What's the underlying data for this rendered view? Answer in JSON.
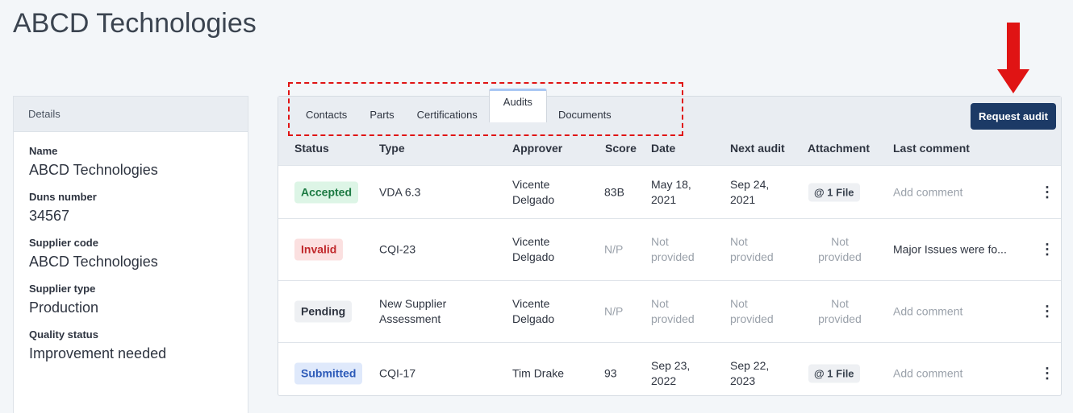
{
  "page_title": "ABCD Technologies",
  "details": {
    "header": "Details",
    "fields": [
      {
        "label": "Name",
        "value": "ABCD Technologies"
      },
      {
        "label": "Duns number",
        "value": "34567"
      },
      {
        "label": "Supplier code",
        "value": "ABCD Technologies"
      },
      {
        "label": "Supplier type",
        "value": "Production"
      },
      {
        "label": "Quality status",
        "value": "Improvement needed"
      }
    ]
  },
  "tabs": [
    "Contacts",
    "Parts",
    "Certifications",
    "Audits",
    "Documents"
  ],
  "active_tab": "Audits",
  "request_button": "Request audit",
  "columns": [
    "Status",
    "Type",
    "Approver",
    "Score",
    "Date",
    "Next audit",
    "Attachment",
    "Last comment"
  ],
  "rows": [
    {
      "status": "Accepted",
      "type": "VDA 6.3",
      "approver": "Vicente Delgado",
      "score": "83B",
      "date": "May 18, 2021",
      "next_audit": "Sep 24, 2021",
      "attachment": "1 File",
      "comment": "Add comment"
    },
    {
      "status": "Invalid",
      "type": "CQI-23",
      "approver": "Vicente Delgado",
      "score": "N/P",
      "date": "Not provided",
      "next_audit": "Not provided",
      "attachment": "Not provided",
      "comment": "Major Issues were fo..."
    },
    {
      "status": "Pending",
      "type": "New Supplier Assessment",
      "approver": "Vicente Delgado",
      "score": "N/P",
      "date": "Not provided",
      "next_audit": "Not provided",
      "attachment": "Not provided",
      "comment": "Add comment"
    },
    {
      "status": "Submitted",
      "type": "CQI-17",
      "approver": "Tim Drake",
      "score": "93",
      "date": "Sep 23, 2022",
      "next_audit": "Sep 22, 2023",
      "attachment": "1 File",
      "comment": "Add comment"
    }
  ],
  "colors": {
    "primary_button": "#1c3a66",
    "annotation": "#e01414"
  }
}
